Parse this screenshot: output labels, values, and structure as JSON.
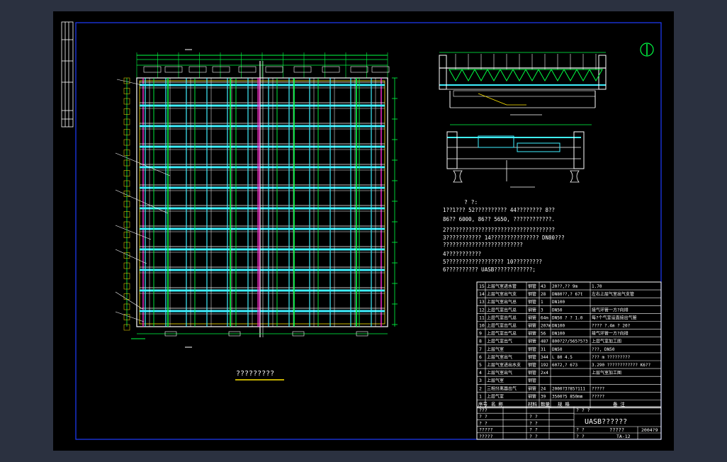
{
  "drawing": {
    "plan_caption": "?????????",
    "notes_heading": "?    ?:",
    "notes": [
      "1??1???  52??????????    44????????  8??",
      "  86?? 6000, 86?? 5650, ????????????.",
      "2??????????????????????????????????",
      "3???????????    14???????????????      DN80???",
      "  ?????????????????????????",
      "4???????????",
      "5??????????????????          10?????????",
      "6??????????      UASB????????????;"
    ],
    "parts": [
      {
        "no": "15",
        "name": "上层气室进水管",
        "mat": "钢管",
        "qty": "43",
        "spec": "20??,??  9m",
        "note": "1.70"
      },
      {
        "no": "14",
        "name": "上层气室出气支",
        "mat": "钢管",
        "qty": "28",
        "spec": "DN80??,?  67t",
        "note": "左右上层气室出气支管"
      },
      {
        "no": "13",
        "name": "上层气室出气总",
        "mat": "钢管",
        "qty": "1",
        "spec": "DN100",
        "note": ""
      },
      {
        "no": "12",
        "name": "上层气室出气总",
        "mat": "钢管",
        "qty": "3",
        "spec": "DN50",
        "note": "接气环管一方?向排"
      },
      {
        "no": "11",
        "name": "上层气室出气总",
        "mat": "钢管",
        "qty": "64m",
        "spec": "DN50 ? ? 1.0",
        "note": "每?个气室设直接出气管"
      },
      {
        "no": "10",
        "name": "上层气室出气总",
        "mat": "钢管",
        "qty": "207m",
        "spec": "DN100",
        "note": "????  ?.4m ? 20?"
      },
      {
        "no": "9",
        "name": "上层气室出气总",
        "mat": "钢管",
        "qty": "56",
        "spec": "DN100",
        "note": "接气环管一方?向排"
      },
      {
        "no": "8",
        "name": "上层气室出气",
        "mat": "钢管",
        "qty": "487",
        "spec": "800?2?/565?5?3",
        "note": "上层气室加工图"
      },
      {
        "no": "7",
        "name": "上层气室",
        "mat": "钢管",
        "qty": "31",
        "spec": "DN50",
        "note": "???, DN50"
      },
      {
        "no": "6",
        "name": "上层气室出气",
        "mat": "钢管",
        "qty": "344",
        "spec": "L 80 4.5",
        "note": "???  m   ?????????"
      },
      {
        "no": "5",
        "name": "上层气室进出水支",
        "mat": "钢管",
        "qty": "192",
        "spec": "6072,?   673",
        "note": "3.290   ????????????     K6??"
      },
      {
        "no": "4",
        "name": "上层气室出气",
        "mat": "钢管",
        "qty": "2x4",
        "spec": "",
        "note": "上层气室加工图"
      },
      {
        "no": "3",
        "name": "上层气室",
        "mat": "钢管",
        "qty": "",
        "spec": "",
        "note": ""
      },
      {
        "no": "2",
        "name": "三相分离器出气",
        "mat": "钢管",
        "qty": "24",
        "spec": "2000?3?85?111",
        "note": "?????"
      },
      {
        "no": "1",
        "name": "上层气室",
        "mat": "钢管",
        "qty": "39",
        "spec": "3500?5 850mm",
        "note": "?????"
      }
    ],
    "parts_header": [
      "序号",
      "名  称",
      "材料",
      "数量",
      "规  格",
      "备  注"
    ],
    "title_block": {
      "drawing_name": "UASB??????",
      "subtitle": "?????",
      "drawing_no": "2004?9",
      "sheet": "TA-12",
      "rows": [
        {
          "label": "???",
          "c2": "",
          "c3": "?  ?  ?"
        },
        {
          "label": "?  ?",
          "c2": "?  ?",
          "c3": ""
        },
        {
          "label": "?  ?",
          "c2": "?  ?",
          "c3": ""
        },
        {
          "label": "?????",
          "c2": "?  ?",
          "c3": "?  ?"
        },
        {
          "label": "?????",
          "c2": "?  ?",
          "c3": "?  ?"
        }
      ]
    }
  }
}
